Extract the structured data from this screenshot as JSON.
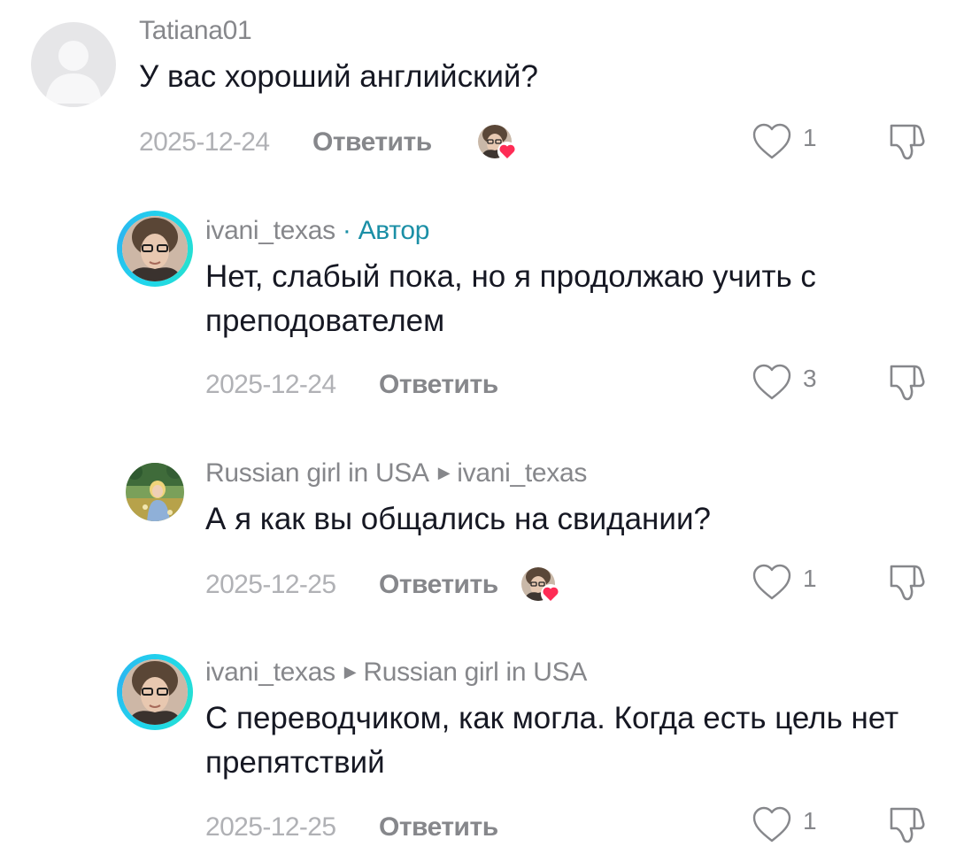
{
  "comments": [
    {
      "username": "Tatiana01",
      "author_badge": "",
      "reply_to": "",
      "text": "У вас хороший английский?",
      "date": "2025-12-24",
      "reply_label": "Ответить",
      "likes": "1",
      "creator_liked": true,
      "avatar": "default-avatar"
    },
    {
      "username": "ivani_texas",
      "author_badge": "· Автор",
      "reply_to": "",
      "text": "Нет, слабый пока, но я продолжаю учить с преподователем",
      "date": "2025-12-24",
      "reply_label": "Ответить",
      "likes": "3",
      "creator_liked": false,
      "avatar": "author-avatar"
    },
    {
      "username": "Russian girl in USA",
      "author_badge": "",
      "reply_to": "ivani_texas",
      "text": "А я как вы общались на свидании?",
      "date": "2025-12-25",
      "reply_label": "Ответить",
      "likes": "1",
      "creator_liked": true,
      "avatar": "photo-avatar"
    },
    {
      "username": "ivani_texas",
      "author_badge": "",
      "reply_to": "Russian girl in USA",
      "text": "С переводчиком, как могла. Когда есть цель нет препятствий",
      "date": "2025-12-25",
      "reply_label": "Ответить",
      "likes": "1",
      "creator_liked": false,
      "avatar": "author-avatar"
    }
  ],
  "colors": {
    "author_badge": "#1b8fa6",
    "ring": "#20d5ec",
    "heart_badge": "#fe2c55",
    "muted_text": "#86878b",
    "date_text": "#b0b1b5"
  }
}
